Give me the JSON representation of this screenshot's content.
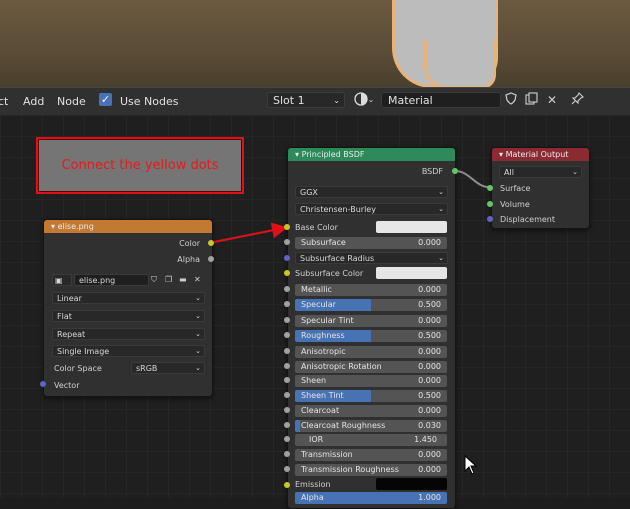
{
  "header": {
    "menu": [
      {
        "label": "ct"
      },
      {
        "label": "Add"
      },
      {
        "label": "Node"
      }
    ],
    "use_nodes_label": "Use Nodes",
    "use_nodes_checked": true,
    "slot": "Slot 1",
    "material_name": "Material"
  },
  "instruction": "Connect the yellow dots",
  "image_node": {
    "title": "elise.png",
    "outputs": [
      "Color",
      "Alpha"
    ],
    "image_file": "elise.png",
    "interpolation": "Linear",
    "projection": "Flat",
    "extension": "Repeat",
    "source": "Single Image",
    "color_space_label": "Color Space",
    "color_space": "sRGB",
    "input_vector": "Vector"
  },
  "bsdf_node": {
    "title": "Principled BSDF",
    "output": "BSDF",
    "distribution": "GGX",
    "subsurface_method": "Christensen-Burley",
    "base_color_label": "Base Color",
    "subsurface_radius_label": "Subsurface Radius",
    "subsurface_color_label": "Subsurface Color",
    "emission_label": "Emission",
    "fields": [
      {
        "label": "Subsurface",
        "value": "0.000",
        "fill": 0
      },
      {
        "label": "Metallic",
        "value": "0.000",
        "fill": 0
      },
      {
        "label": "Specular",
        "value": "0.500",
        "fill": 0.5
      },
      {
        "label": "Specular Tint",
        "value": "0.000",
        "fill": 0
      },
      {
        "label": "Roughness",
        "value": "0.500",
        "fill": 0.5
      },
      {
        "label": "Anisotropic",
        "value": "0.000",
        "fill": 0
      },
      {
        "label": "Anisotropic Rotation",
        "value": "0.000",
        "fill": 0
      },
      {
        "label": "Sheen",
        "value": "0.000",
        "fill": 0
      },
      {
        "label": "Sheen Tint",
        "value": "0.500",
        "fill": 0.5
      },
      {
        "label": "Clearcoat",
        "value": "0.000",
        "fill": 0
      },
      {
        "label": "Clearcoat Roughness",
        "value": "0.030",
        "fill": 0.03
      },
      {
        "label": "IOR",
        "value": "1.450",
        "fill": 0
      },
      {
        "label": "Transmission",
        "value": "0.000",
        "fill": 0
      },
      {
        "label": "Transmission Roughness",
        "value": "0.000",
        "fill": 0
      },
      {
        "label": "Alpha",
        "value": "1.000",
        "fill": 1
      }
    ]
  },
  "output_node": {
    "title": "Material Output",
    "target": "All",
    "inputs": [
      "Surface",
      "Volume",
      "Displacement"
    ]
  },
  "colors": {
    "image_header": "#c27a32",
    "bsdf_header": "#2d8a5a",
    "output_header": "#8c2a33",
    "socket_yellow": "#c7c729",
    "accent_blue": "#4772b3",
    "instruction_border": "#e0101a"
  }
}
